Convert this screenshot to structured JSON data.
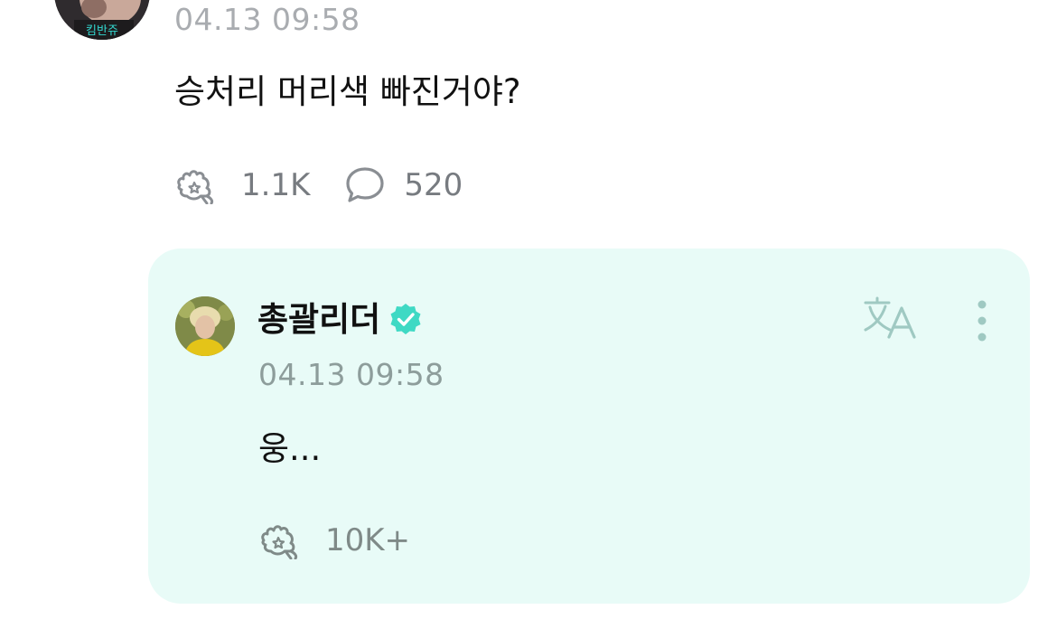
{
  "post": {
    "avatar_caption": "킴반쥬",
    "time": "04.13 09:58",
    "text": "승처리 머리색 빠진거야?",
    "like_count": "1.1K",
    "comment_count": "520"
  },
  "reply": {
    "author": "총괄리더",
    "time": "04.13 09:58",
    "text": "웅...",
    "like_count": "10K+"
  },
  "colors": {
    "card_background": "#e8fbf7",
    "verified_badge": "#3fd9c4",
    "meta_text": "#a9acb0",
    "icon_gray": "#8a8e93"
  },
  "icons": {
    "like": "reaction-hand-icon",
    "comment": "speech-bubble-icon",
    "verified": "verified-badge-icon",
    "translate": "translate-icon",
    "more": "more-vertical-icon"
  }
}
